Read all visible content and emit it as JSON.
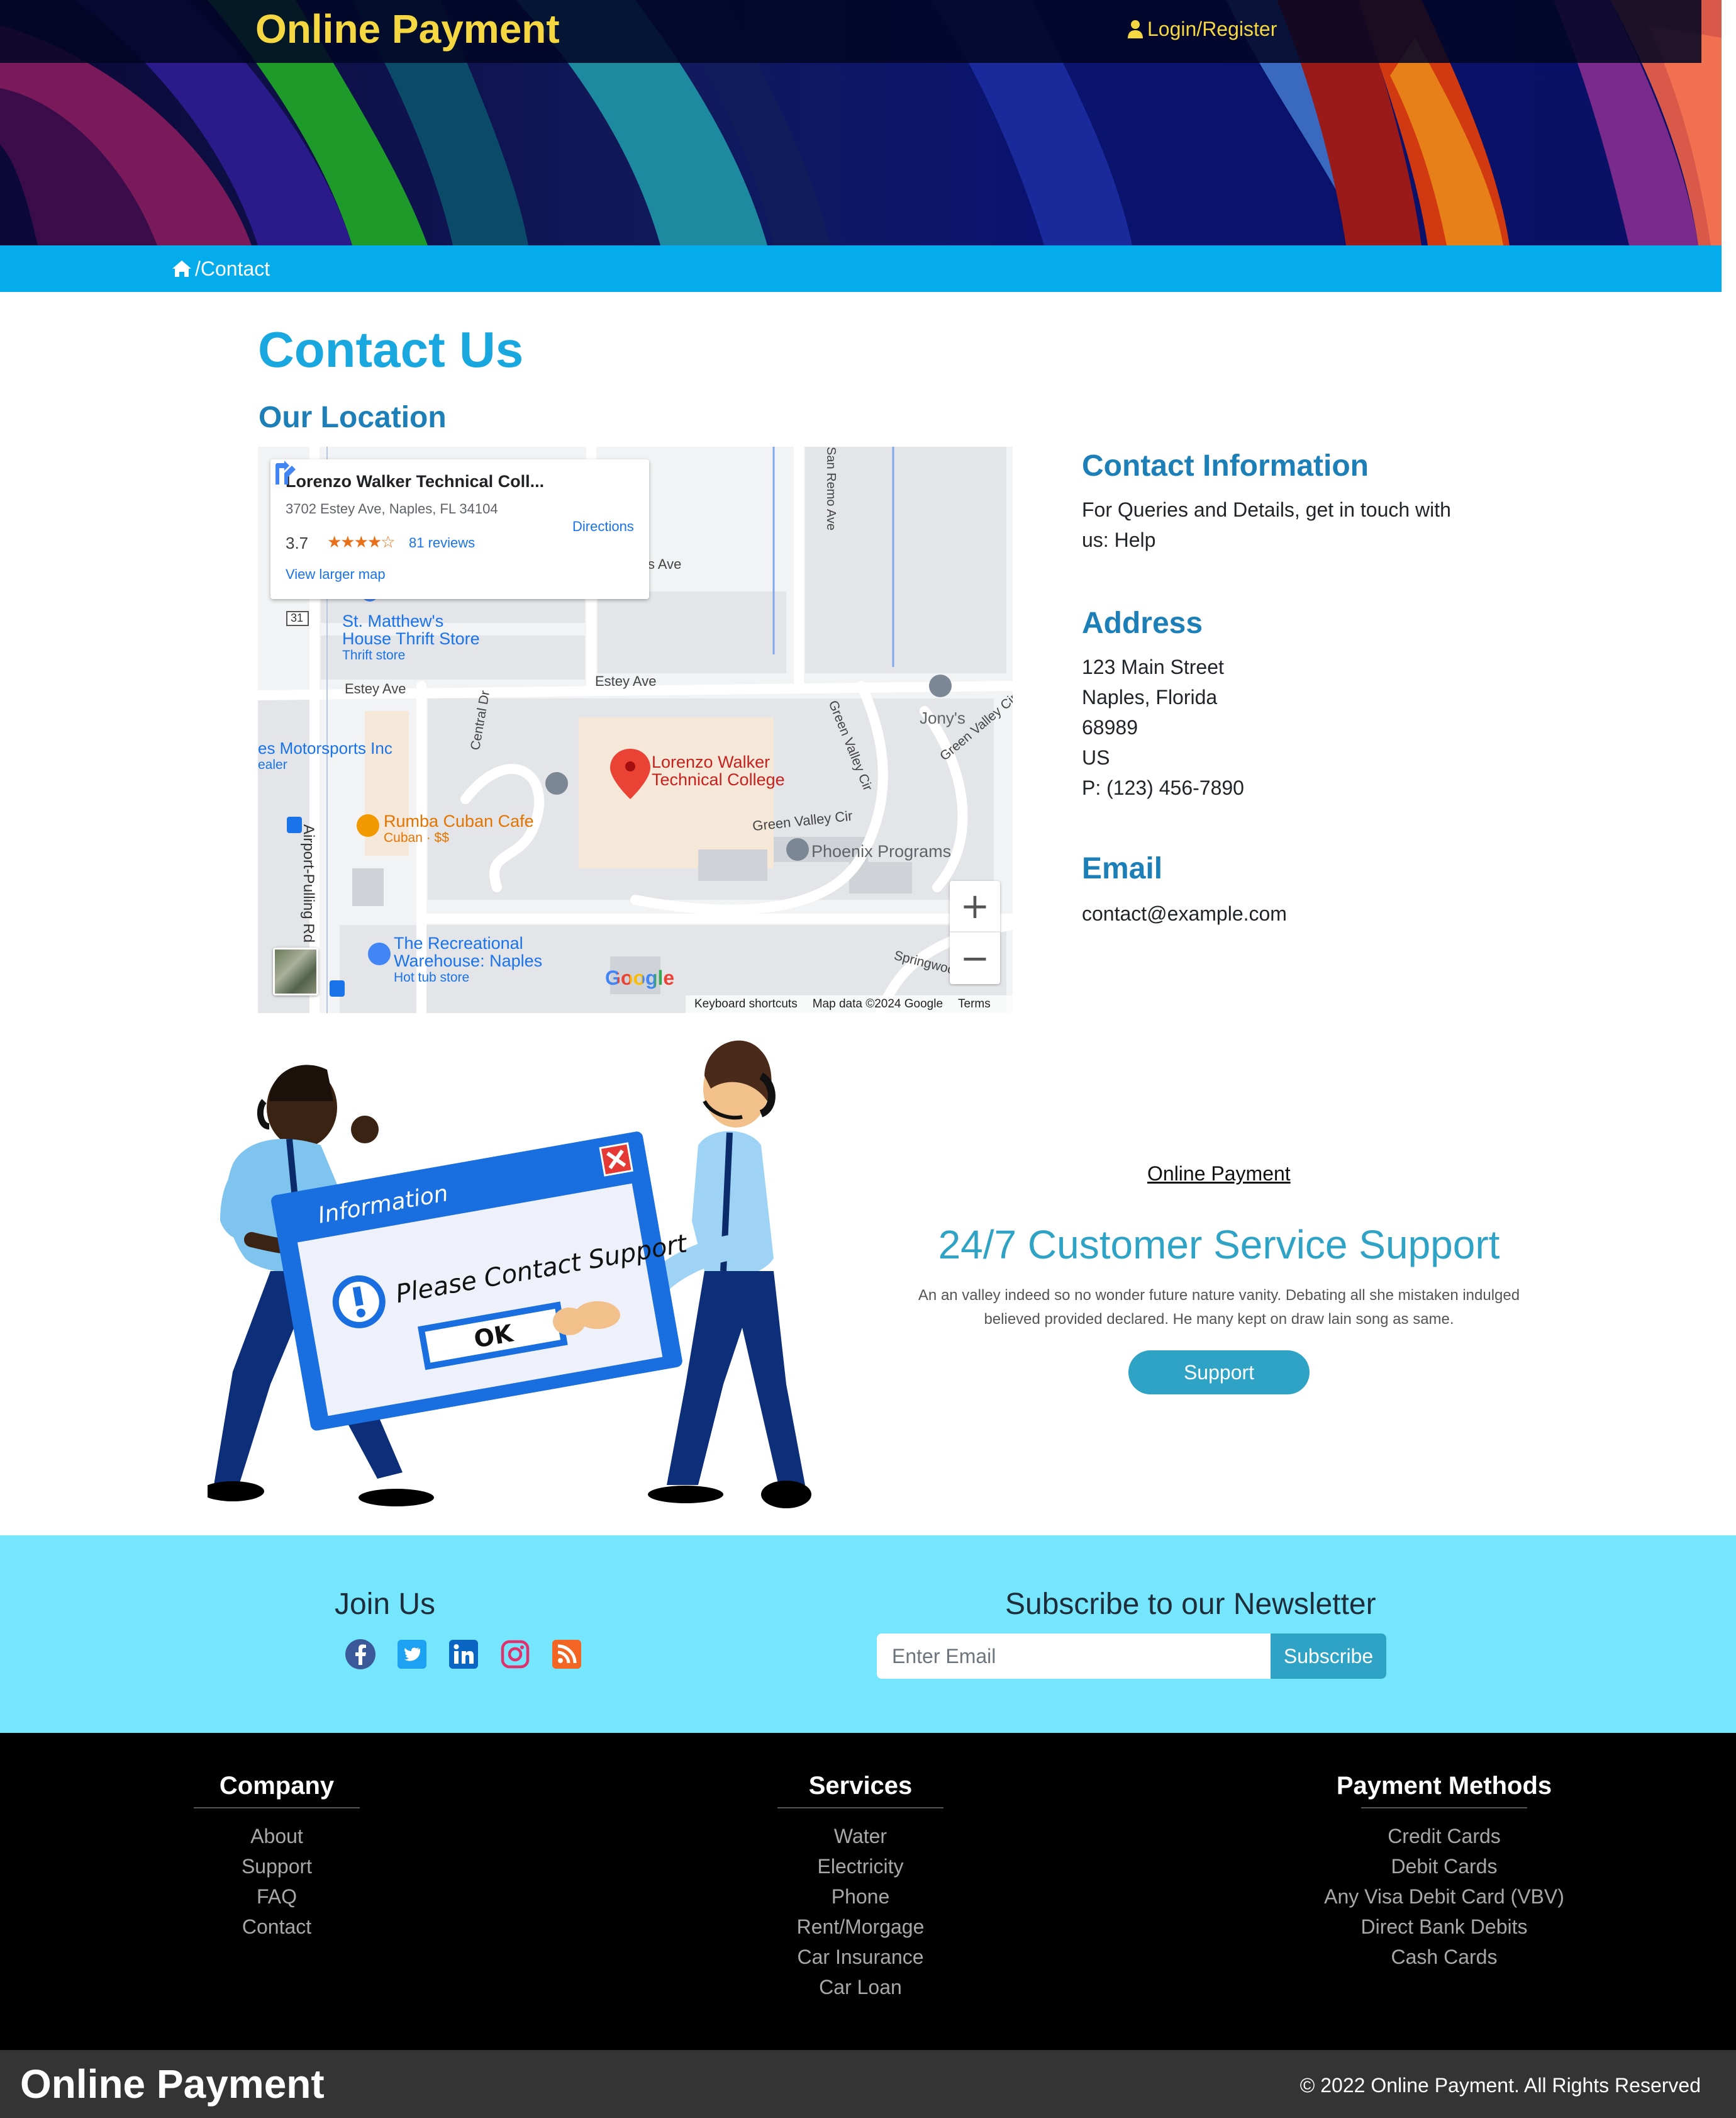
{
  "header": {
    "brand": "Online Payment",
    "login_label": "Login/Register"
  },
  "breadcrumb": {
    "current": "/Contact"
  },
  "contact": {
    "title": "Contact Us",
    "location_heading": "Our Location",
    "info_heading": "Contact Information",
    "info_text_line1": "For Queries and Details, get in touch with",
    "info_text_line2": "us: Help",
    "address_heading": "Address",
    "address_lines": [
      "123 Main Street",
      "Naples, Florida",
      "68989",
      "US",
      "P: (123) 456-7890"
    ],
    "email_heading": "Email",
    "email": "contact@example.com"
  },
  "map": {
    "place_name": "Lorenzo Walker Technical Coll...",
    "place_address": "3702 Estey Ave, Naples, FL 34104",
    "rating": "3.7",
    "stars": "★★★★☆",
    "reviews": "81 reviews",
    "view_larger": "View larger map",
    "directions": "Directions",
    "zoom_in": "+",
    "zoom_out": "−",
    "google": "Google",
    "footer": {
      "shortcuts": "Keyboard shortcuts",
      "data": "Map data ©2024 Google",
      "terms": "Terms"
    },
    "labels": {
      "st_matthews_1": "St. Matthew's",
      "st_matthews_2": "House Thrift Store",
      "thrift": "Thrift store",
      "estey_ave_left": "Estey Ave",
      "estey_ave_mid": "Estey Ave",
      "s_ave": "s Ave",
      "motorsports": "es Motorsports Inc",
      "dealer": "ealer",
      "central_dr": "Central Dr",
      "lwtc_1": "Lorenzo Walker",
      "lwtc_2": "Technical College",
      "green_valley_cir_1": "Green Valley Cir",
      "green_valley_cir_2": "Green Valley Cir",
      "green_valley_cir_3": "Green Valley Cir",
      "jonys": "Jony's",
      "rumba": "Rumba Cuban Cafe",
      "rumba_sub": "Cuban · $$",
      "phoenix": "Phoenix Programs",
      "airport_pulling": "Airport-Pulling Rd S",
      "san_remo": "San Remo Ave",
      "recreational_1": "The Recreational",
      "recreational_2": "Warehouse: Naples",
      "hot_tub": "Hot tub store",
      "springwood": "Springwood",
      "route_31": "31"
    }
  },
  "support": {
    "illustration_title": "Information",
    "illustration_message": "Please Contact Support",
    "illustration_ok": "OK",
    "brand_link": "Online Payment",
    "heading": "24/7 Customer Service Support",
    "text_line1": "An an valley indeed so no wonder future nature vanity. Debating all she mistaken indulged",
    "text_line2": "believed provided declared. He many kept on draw lain song as same.",
    "button": "Support"
  },
  "join": {
    "heading": "Join Us",
    "social_icons": [
      "facebook-icon",
      "twitter-icon",
      "linkedin-icon",
      "instagram-icon",
      "rss-icon"
    ],
    "newsletter_heading": "Subscribe to our Newsletter",
    "email_placeholder": "Enter Email",
    "subscribe_button": "Subscribe"
  },
  "footer": {
    "columns": [
      {
        "title": "Company",
        "links": [
          "About",
          "Support",
          "FAQ",
          "Contact"
        ]
      },
      {
        "title": "Services",
        "links": [
          "Water",
          "Electricity",
          "Phone",
          "Rent/Morgage",
          "Car Insurance",
          "Car Loan"
        ]
      },
      {
        "title": "Payment Methods",
        "links": [
          "Credit Cards",
          "Debit Cards",
          "Any Visa Debit Card (VBV)",
          "Direct Bank Debits",
          "Cash Cards"
        ]
      }
    ],
    "brand": "Online Payment",
    "copyright": "© 2022 Online Payment. All Rights Reserved"
  },
  "colors": {
    "brand_yellow": "#f5d742",
    "breadcrumb_blue": "#04aceb",
    "heading_blue": "#19a7e0",
    "subheading_blue": "#1d7fb8",
    "support_teal": "#2fa3c6",
    "join_bg": "#76e6fe",
    "footer_bg": "#000000",
    "bottom_bar": "#343434"
  }
}
